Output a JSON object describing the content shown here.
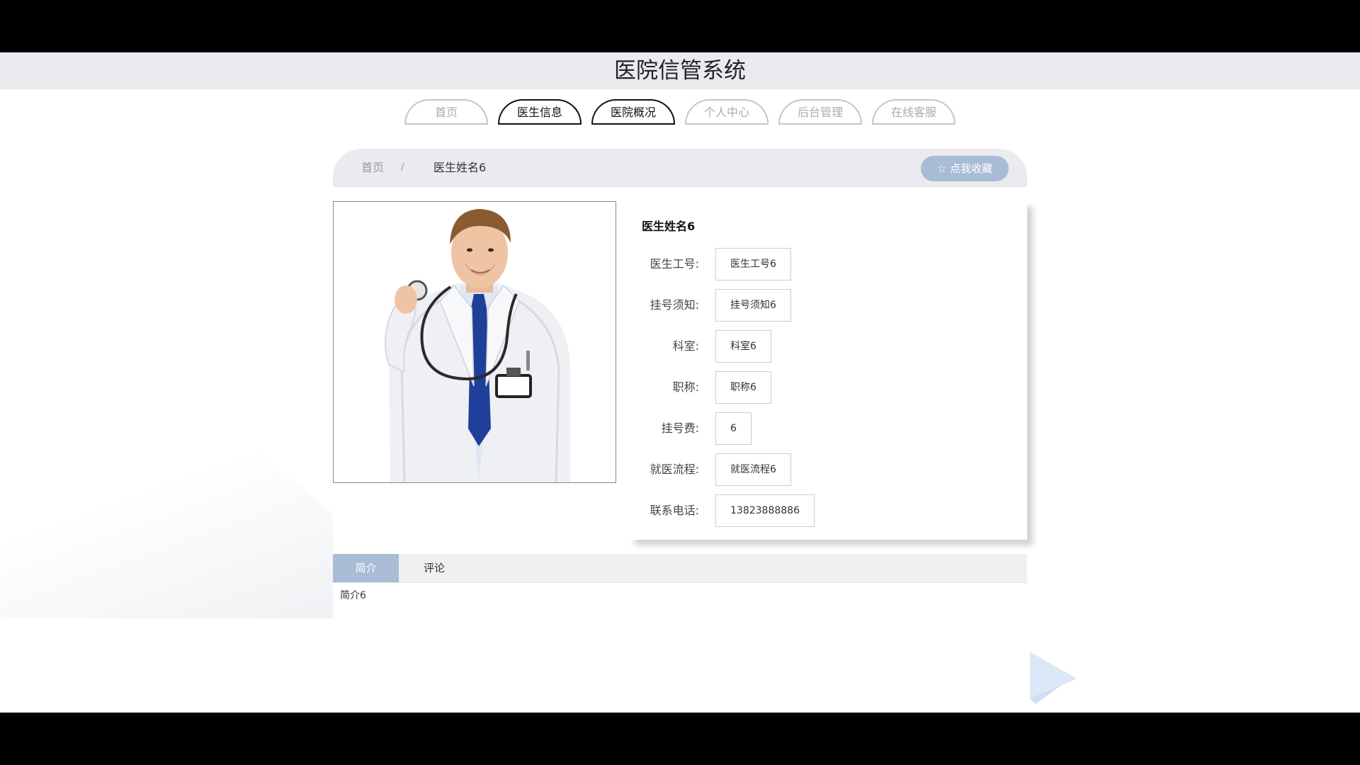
{
  "header": {
    "title": "医院信管系统"
  },
  "nav": {
    "items": [
      {
        "label": "首页"
      },
      {
        "label": "医生信息"
      },
      {
        "label": "医院概况"
      },
      {
        "label": "个人中心"
      },
      {
        "label": "后台管理"
      },
      {
        "label": "在线客服"
      }
    ]
  },
  "breadcrumb": {
    "home": "首页",
    "separator": "/",
    "current": "医生姓名6"
  },
  "favorite_button": {
    "label": "☆ 点我收藏",
    "icon": "star-icon"
  },
  "doctor": {
    "name": "医生姓名6",
    "fields": [
      {
        "label": "医生工号:",
        "value": "医生工号6"
      },
      {
        "label": "挂号须知:",
        "value": "挂号须知6"
      },
      {
        "label": "科室:",
        "value": "科室6"
      },
      {
        "label": "职称:",
        "value": "职称6"
      },
      {
        "label": "挂号费:",
        "value": "6"
      },
      {
        "label": "就医流程:",
        "value": "就医流程6"
      },
      {
        "label": "联系电话:",
        "value": "13823888886"
      }
    ]
  },
  "tabs": {
    "items": [
      {
        "label": "简介"
      },
      {
        "label": "评论"
      }
    ],
    "content": "简介6"
  },
  "colors": {
    "accent": "#a9bcd6",
    "header_bg": "#e9ebef"
  }
}
